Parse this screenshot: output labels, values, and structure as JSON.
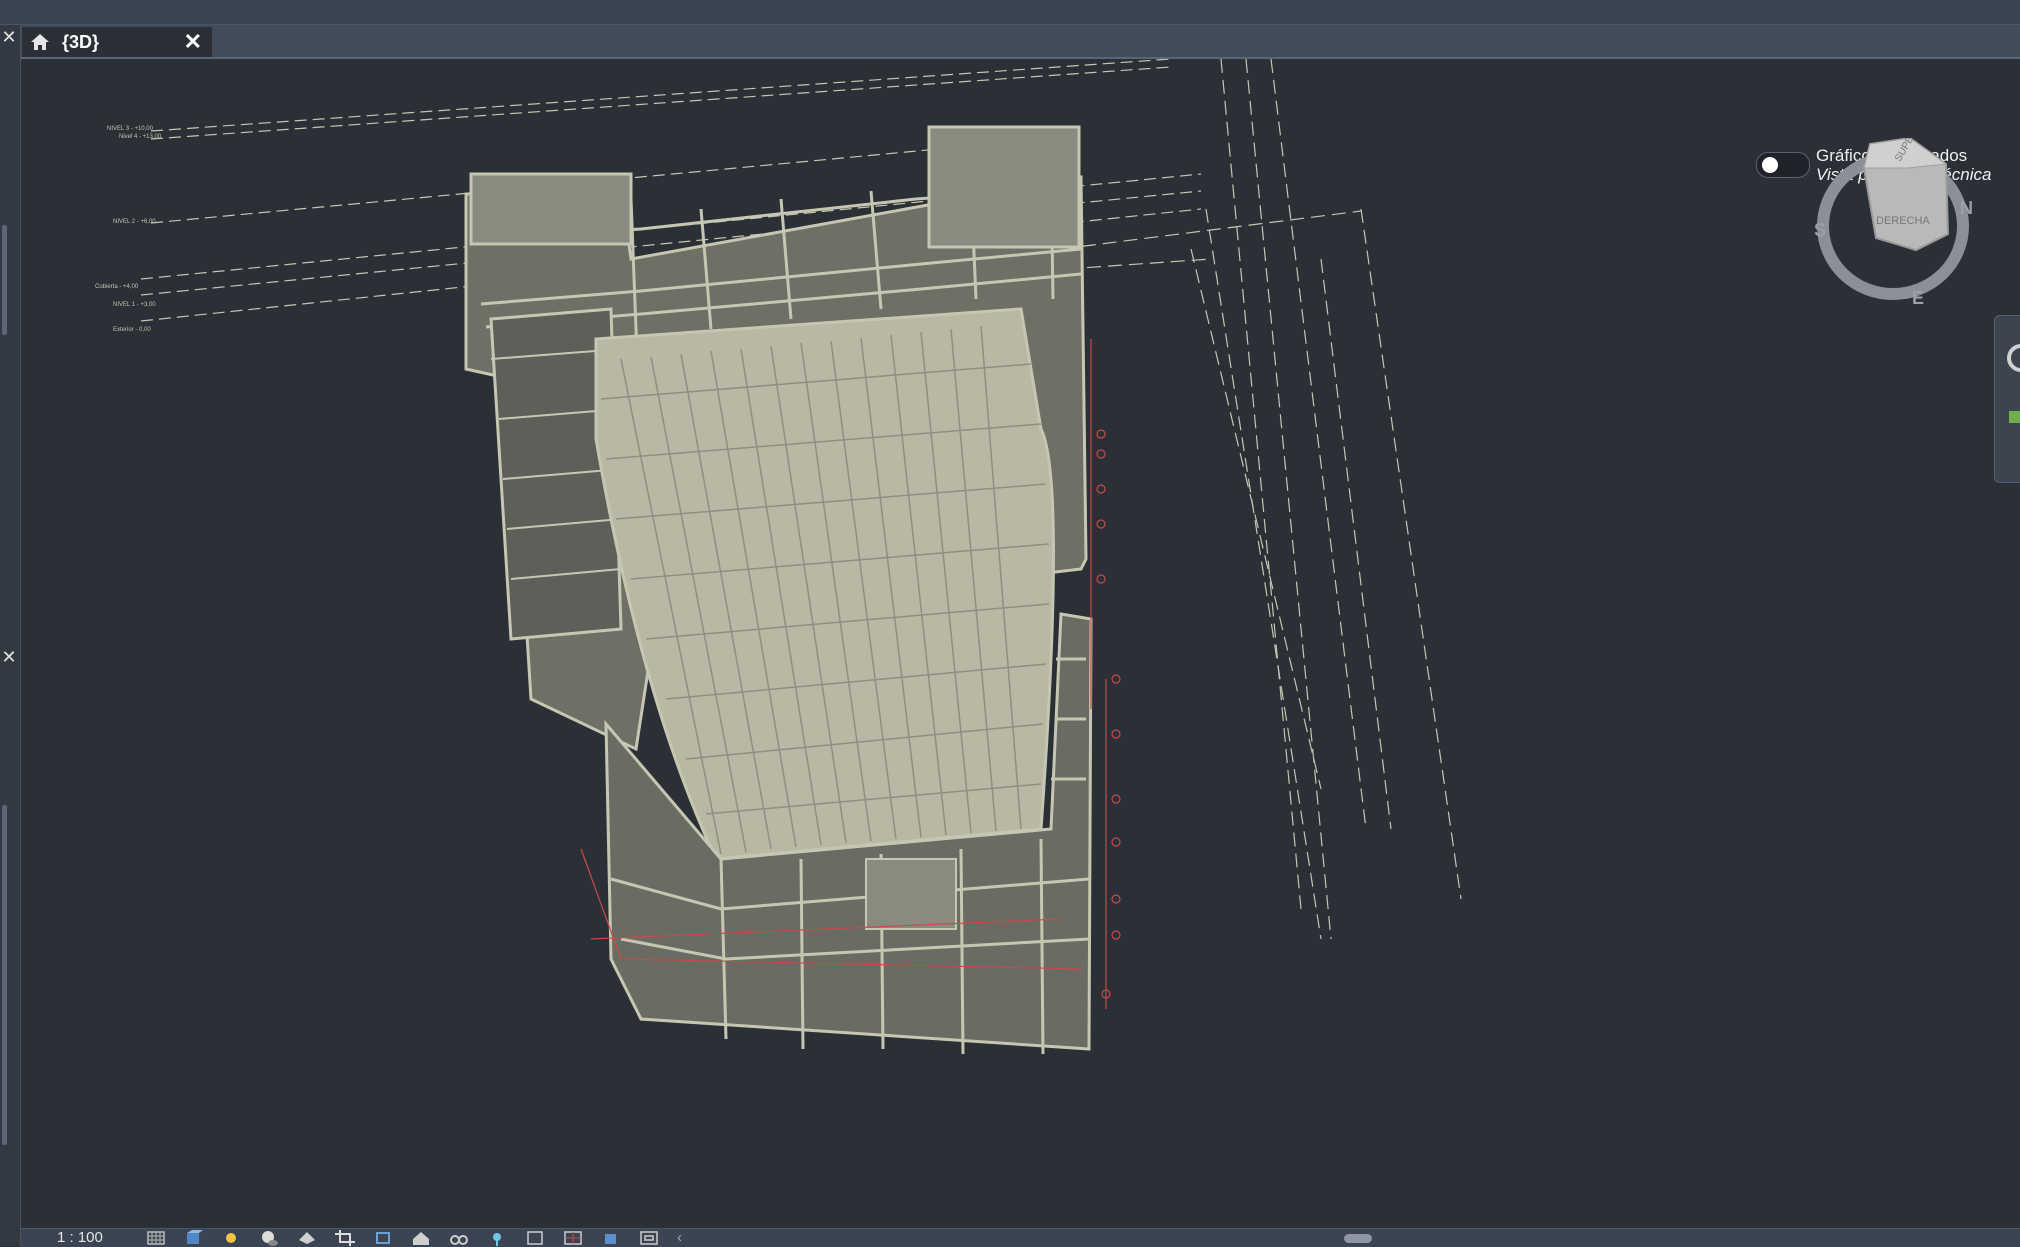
{
  "window": {
    "tab": {
      "label": "{3D}",
      "icon": "home-icon"
    }
  },
  "viewport": {
    "graphics": {
      "title": "Gráficos acelerados",
      "subtitle": "Vista preliminar técnica",
      "enabled": false
    },
    "viewcube": {
      "top_face": "SUPERIOR",
      "front_face": "DERECHA",
      "compass": [
        "N",
        "S",
        "E"
      ]
    },
    "level_labels": [
      "NIVEL 3 - +10,00",
      "Nivel 4 - +13,00",
      "NIVEL 2 - +6,00",
      "Cubierta - +4,00",
      "NIVEL 1 - +3,00",
      "Exterior - 0,00"
    ]
  },
  "statusbar": {
    "scale": "1 : 100",
    "icons": [
      "detail-level-icon",
      "visual-style-icon",
      "sun-path-icon",
      "shadows-icon",
      "render-icon",
      "crop-view-icon",
      "show-crop-region-icon",
      "unlock-3d-view-icon",
      "temporary-hide-icon",
      "reveal-hidden-icon",
      "temporary-view-properties-icon",
      "analytical-model-icon",
      "highlight-displacement-icon",
      "reveal-constraints-icon"
    ]
  },
  "colors": {
    "viewport_bg": "#2b2f36",
    "tab_bar": "#414b5a",
    "model_line": "#c6c7b2",
    "model_fill": "#767669",
    "accent_red": "#c84a4a"
  }
}
